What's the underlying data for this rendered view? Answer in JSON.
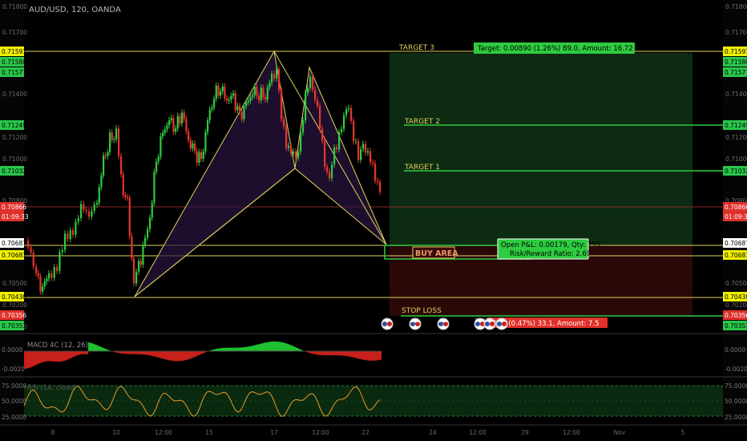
{
  "header": {
    "symbol_title": "AUD/USD, 120, OANDA"
  },
  "price_axis": {
    "ticks": [
      "0.71800",
      "0.71700",
      "0.71400",
      "0.71200",
      "0.71000",
      "0.70800",
      "0.70500",
      "0.70200",
      "0.70000",
      "0.69800"
    ],
    "tags": [
      {
        "label": "0.71591",
        "color": "#f0f000",
        "text_color": "#000000"
      },
      {
        "label": "0.71588",
        "color": "#29c74a",
        "text_color": "#000000"
      },
      {
        "label": "0.71577",
        "color": "#29c74a",
        "text_color": "#000000"
      },
      {
        "label": "0.71249",
        "color": "#29c74a",
        "text_color": "#000000"
      },
      {
        "label": "0.71032",
        "color": "#29c74a",
        "text_color": "#000000"
      },
      {
        "label": "0.70866",
        "color": "#e0302a",
        "text_color": "#ffffff"
      },
      {
        "label": "01:09:33",
        "color": "#e0302a",
        "text_color": "#ffffff"
      },
      {
        "label": "0.70687",
        "color": "#ffffff",
        "text_color": "#000000"
      },
      {
        "label": "0.70681",
        "color": "#f0f000",
        "text_color": "#000000"
      },
      {
        "label": "0.70438",
        "color": "#f0f000",
        "text_color": "#000000"
      },
      {
        "label": "0.70356",
        "color": "#e0302a",
        "text_color": "#ffffff"
      },
      {
        "label": "0.70353",
        "color": "#29c74a",
        "text_color": "#000000"
      }
    ]
  },
  "annotations": {
    "target3": "TARGET 3",
    "target2": "TARGET 2",
    "target1": "TARGET 1",
    "stop_loss": "STOP LOSS",
    "buy_area": "BUY AREA",
    "target_box": "Target: 0.00890 (1.26%) 89.0, Amount: 16.72",
    "pnl_line1": "Open P&L: 0.00179, Qty: 755",
    "pnl_line2": "Risk/Reward Ratio: 2.69",
    "stop_box": "0331 (0.47%) 33.1, Amount: 7.5"
  },
  "event_markers": [
    "3",
    "2 1",
    "4",
    "7 2",
    "34 1",
    "5",
    "1"
  ],
  "macd": {
    "label": "MACD 4C (12, 26)",
    "ticks": [
      "0.0000",
      "-0.0020"
    ]
  },
  "rsi": {
    "label": "RSI (14, close)",
    "ticks": [
      "75.0000",
      "50.0000",
      "25.0000"
    ]
  },
  "time_axis": [
    "8",
    "10",
    "12:00",
    "15",
    "17",
    "12:00",
    "22",
    "24",
    "12:00",
    "29",
    "12:00",
    "Nov",
    "5"
  ],
  "colors": {
    "up": "#2ecc40",
    "down": "#e8352c",
    "target": "#2ecc40",
    "pattern": "#e0d35a"
  }
}
